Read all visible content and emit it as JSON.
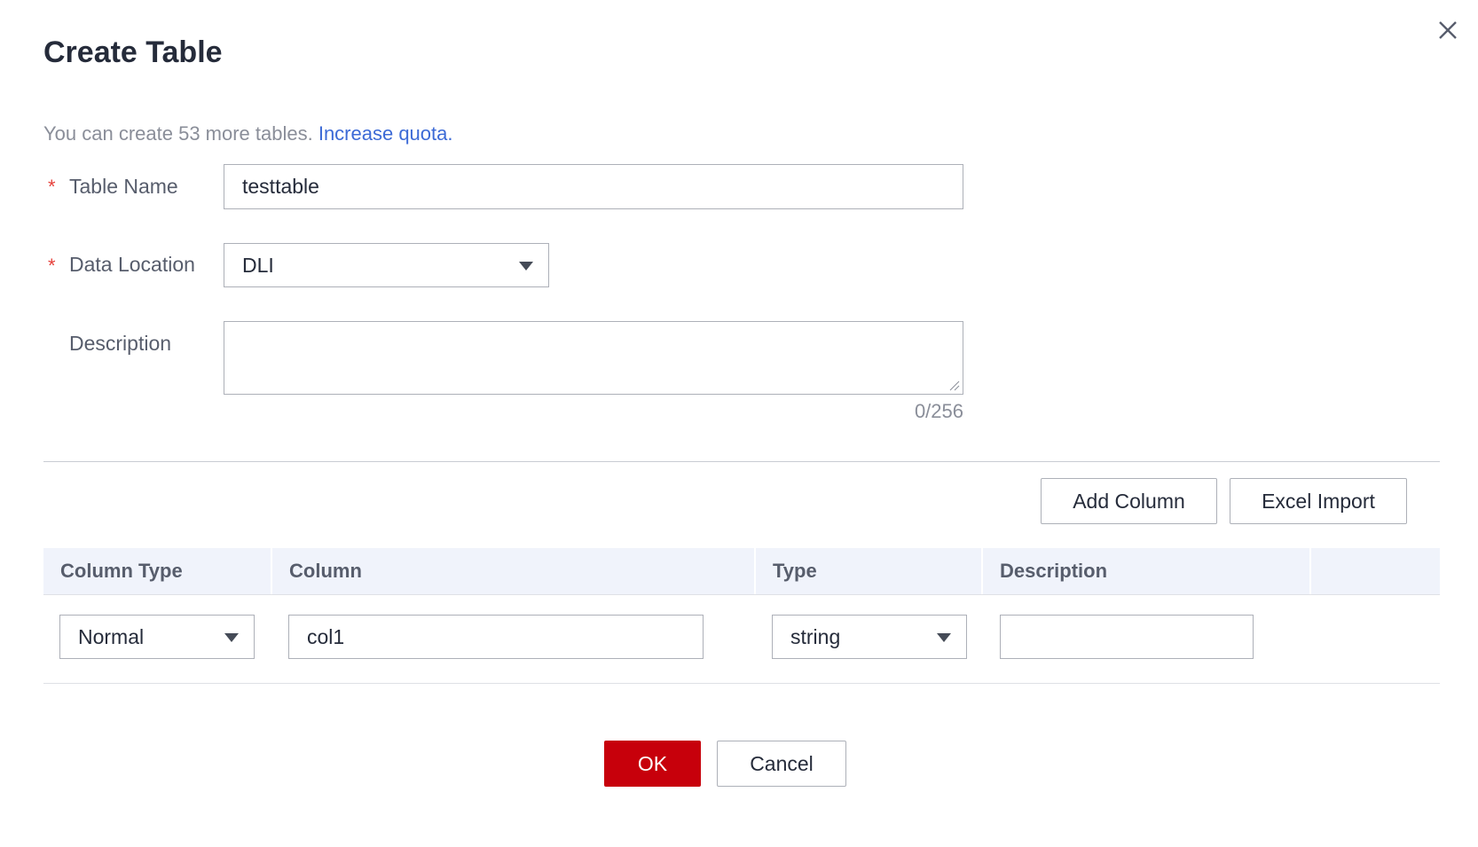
{
  "dialog": {
    "title": "Create Table",
    "close_icon": "close-icon"
  },
  "quota": {
    "text": "You can create 53 more tables. ",
    "link": "Increase quota",
    "suffix": "."
  },
  "form": {
    "required_mark": "*",
    "table_name": {
      "label": "Table Name",
      "value": "testtable"
    },
    "data_location": {
      "label": "Data Location",
      "value": "DLI"
    },
    "description": {
      "label": "Description",
      "value": "",
      "counter": "0/256"
    }
  },
  "actions": {
    "add_column": "Add Column",
    "excel_import": "Excel Import"
  },
  "table": {
    "headers": [
      "Column Type",
      "Column",
      "Type",
      "Description"
    ],
    "rows": [
      {
        "column_type": "Normal",
        "column": "col1",
        "type": "string",
        "description": ""
      }
    ]
  },
  "footer": {
    "ok": "OK",
    "cancel": "Cancel"
  },
  "colors": {
    "primary": "#c7000b",
    "link": "#3c6ad6",
    "required": "#e6423c",
    "header_bg": "#f0f3fb"
  }
}
